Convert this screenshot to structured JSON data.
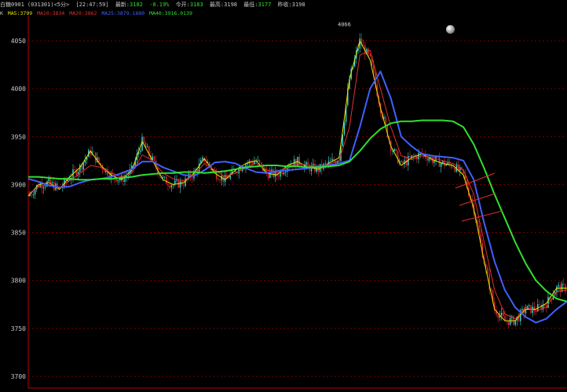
{
  "header": {
    "symbol": "白糖0901",
    "code": "(031301)<5分>",
    "time": "[22:47:59]",
    "latest_label": "最新:",
    "latest": "3182",
    "change": "-0.19%",
    "open_label": "今开:",
    "open": "3183",
    "high_label": "最高:",
    "high": "3198",
    "low_label": "最低:",
    "low": "3177",
    "prev_label": "昨收:",
    "prev": "3198"
  },
  "legend": {
    "prefix": "K",
    "items": [
      {
        "text": "MA5:3799",
        "color": "#e6e600"
      },
      {
        "text": "MA10:3834",
        "color": "#e03030"
      },
      {
        "text": "MA20:3862",
        "color": "#e03030"
      },
      {
        "text": "MA25:3879.1880",
        "color": "#4060ff"
      },
      {
        "text": "MA40:3916.0139",
        "color": "#30e030"
      }
    ]
  },
  "chart_data": {
    "type": "candlestick",
    "y_ticks": [
      4050,
      4000,
      3950,
      3900,
      3850,
      3800,
      3750,
      3700
    ],
    "ylim": [
      3693,
      4082
    ],
    "grid": "horizontal dashed",
    "peak_label": "4066",
    "peak_value": 4066,
    "series": [
      {
        "name": "MA40",
        "color": "#30e030",
        "values": [
          3908,
          3908,
          3907,
          3906,
          3906,
          3905,
          3905,
          3906,
          3906,
          3907,
          3908,
          3910,
          3911,
          3912,
          3912,
          3913,
          3913,
          3912,
          3913,
          3914,
          3916,
          3918,
          3919,
          3920,
          3920,
          3919,
          3919,
          3918,
          3918,
          3919,
          3920,
          3924,
          3935,
          3948,
          3958,
          3964,
          3966,
          3966,
          3967,
          3967,
          3967,
          3966,
          3960,
          3942,
          3917,
          3890,
          3865,
          3840,
          3818,
          3800,
          3789,
          3781,
          3778
        ]
      },
      {
        "name": "MA25",
        "color": "#4060ff",
        "values": [
          3906,
          3903,
          3899,
          3897,
          3898,
          3902,
          3905,
          3906,
          3908,
          3912,
          3916,
          3924,
          3924,
          3918,
          3914,
          3910,
          3909,
          3915,
          3923,
          3924,
          3922,
          3917,
          3913,
          3912,
          3914,
          3915,
          3916,
          3917,
          3919,
          3920,
          3922,
          3925,
          3960,
          4000,
          4018,
          3990,
          3950,
          3940,
          3932,
          3930,
          3929,
          3928,
          3925,
          3905,
          3860,
          3820,
          3790,
          3772,
          3762,
          3756,
          3760,
          3770,
          3778
        ]
      },
      {
        "name": "MA10",
        "color": "#e03030",
        "values": [
          3890,
          3898,
          3900,
          3896,
          3904,
          3912,
          3920,
          3918,
          3912,
          3908,
          3912,
          3931,
          3925,
          3912,
          3906,
          3904,
          3910,
          3922,
          3915,
          3908,
          3912,
          3918,
          3922,
          3915,
          3913,
          3918,
          3922,
          3920,
          3918,
          3921,
          3925,
          3960,
          4035,
          4040,
          4000,
          3960,
          3930,
          3926,
          3930,
          3928,
          3925,
          3922,
          3915,
          3890,
          3840,
          3790,
          3765,
          3760,
          3772,
          3768,
          3772,
          3788,
          3790
        ]
      },
      {
        "name": "MA5",
        "color": "#e6e600",
        "values": [
          3888,
          3900,
          3902,
          3895,
          3908,
          3918,
          3935,
          3920,
          3910,
          3905,
          3915,
          3945,
          3925,
          3905,
          3900,
          3902,
          3912,
          3927,
          3912,
          3905,
          3915,
          3922,
          3925,
          3912,
          3910,
          3920,
          3924,
          3918,
          3916,
          3922,
          3928,
          4010,
          4050,
          4030,
          3980,
          3940,
          3920,
          3928,
          3932,
          3926,
          3922,
          3920,
          3910,
          3875,
          3820,
          3770,
          3758,
          3758,
          3770,
          3770,
          3776,
          3792,
          3792
        ]
      }
    ]
  }
}
